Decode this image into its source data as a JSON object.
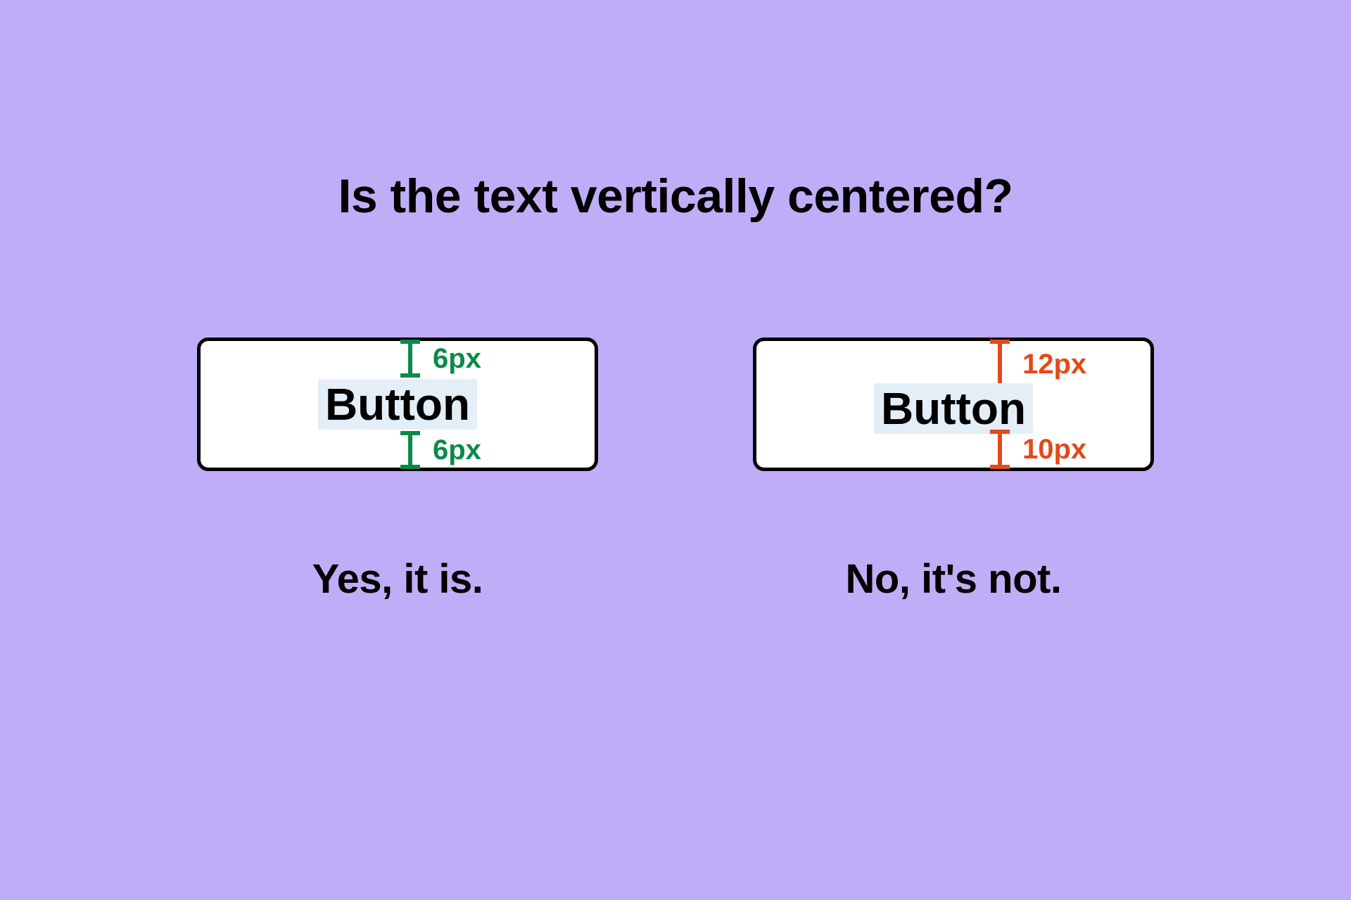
{
  "title": "Is the text vertically centered?",
  "examples": {
    "left": {
      "button_label": "Button",
      "top_measure": "6px",
      "bottom_measure": "6px",
      "caption": "Yes, it is.",
      "color": "#0a8a49"
    },
    "right": {
      "button_label": "Button",
      "top_measure": "12px",
      "bottom_measure": "10px",
      "caption": "No, it's not.",
      "color": "#e24a1a"
    }
  }
}
